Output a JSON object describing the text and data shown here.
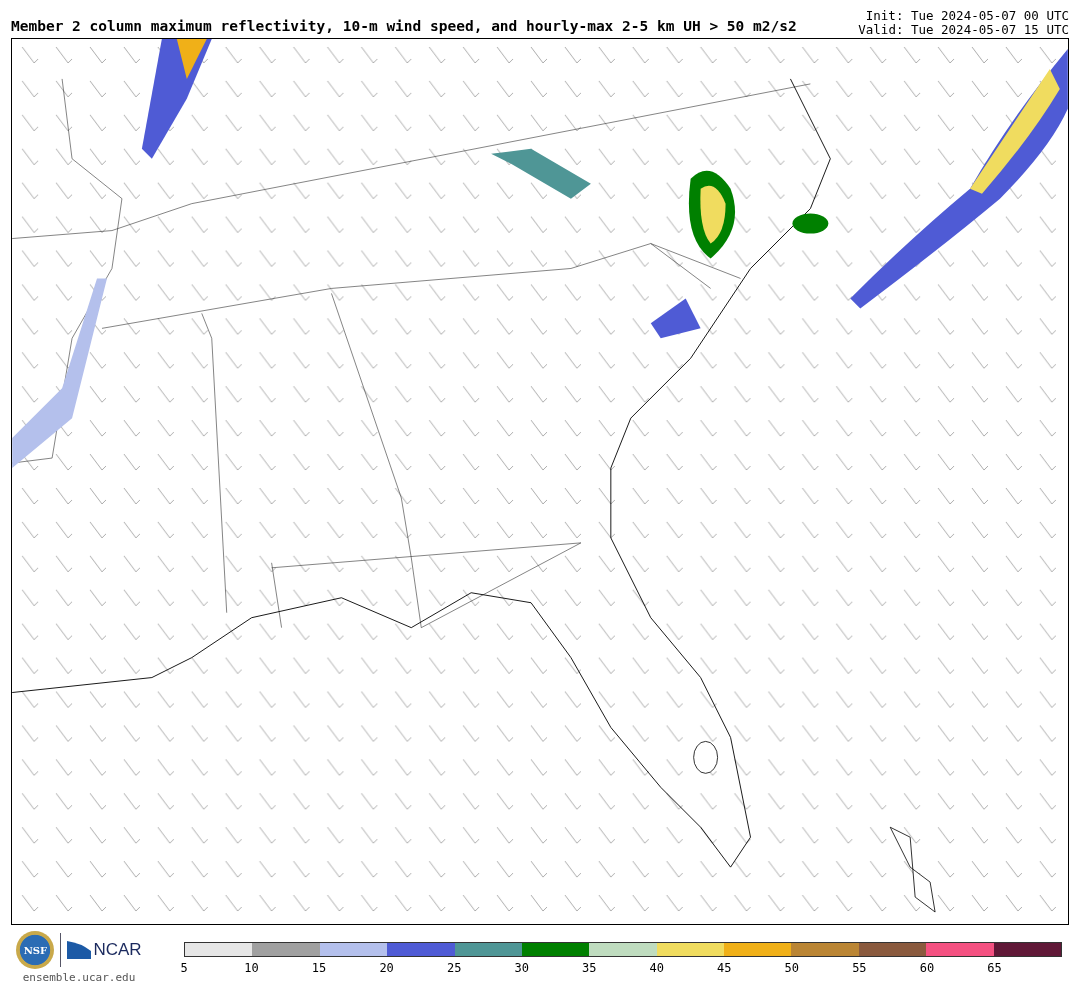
{
  "title": "Member 2 column maximum reflectivity, 10-m wind speed, and hourly-max 2-5 km UH > 50 m2/s2",
  "init": "Init: Tue 2024-05-07 00 UTC",
  "valid": "Valid: Tue 2024-05-07 15 UTC",
  "logos": {
    "nsf": "NSF",
    "ncar": "NCAR",
    "site": "ensemble.ucar.edu"
  },
  "colorbar": {
    "segments": [
      {
        "color": "#e6e6e6",
        "label": "5"
      },
      {
        "color": "#a0a0a0",
        "label": "10"
      },
      {
        "color": "#b4c0ec",
        "label": "15"
      },
      {
        "color": "#4f5bd5",
        "label": "20"
      },
      {
        "color": "#4f9696",
        "label": "25"
      },
      {
        "color": "#008000",
        "label": "30"
      },
      {
        "color": "#bfdcbf",
        "label": "35"
      },
      {
        "color": "#f0dc5f",
        "label": "40"
      },
      {
        "color": "#f0b018",
        "label": "45"
      },
      {
        "color": "#ba8534",
        "label": "50"
      },
      {
        "color": "#8a5a3e",
        "label": "55"
      },
      {
        "color": "#f45181",
        "label": "60"
      },
      {
        "color": "#601837",
        "label": "65"
      }
    ]
  }
}
